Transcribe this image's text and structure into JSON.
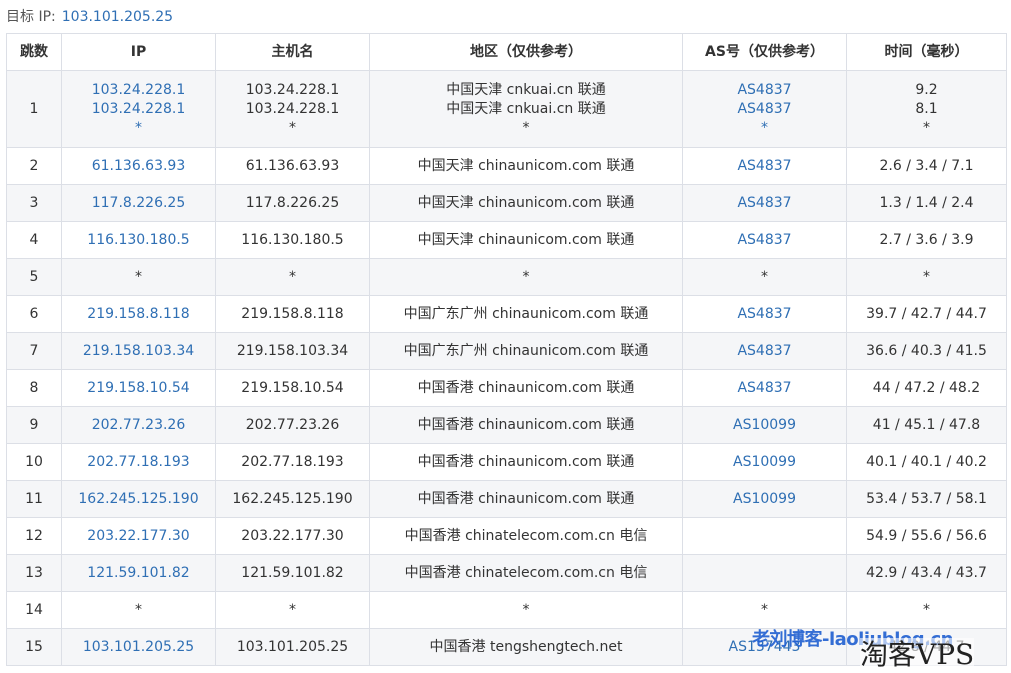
{
  "target": {
    "label": "目标 IP:",
    "ip": "103.101.205.25"
  },
  "headers": {
    "hop": "跳数",
    "ip": "IP",
    "host": "主机名",
    "region": "地区（仅供参考）",
    "as": "AS号（仅供参考）",
    "time": "时间（毫秒）"
  },
  "rows": [
    {
      "hop": "1",
      "ips": [
        "103.24.228.1",
        "103.24.228.1",
        "*"
      ],
      "hosts": [
        "103.24.228.1",
        "103.24.228.1",
        "*"
      ],
      "regions": [
        "中国天津 cnkuai.cn 联通",
        "中国天津 cnkuai.cn 联通",
        "*"
      ],
      "as": [
        "AS4837",
        "AS4837",
        "*"
      ],
      "times": [
        "9.2",
        "8.1",
        "*"
      ]
    },
    {
      "hop": "2",
      "ip": "61.136.63.93",
      "host": "61.136.63.93",
      "region": "中国天津 chinaunicom.com 联通",
      "as": "AS4837",
      "time": "2.6 / 3.4 / 7.1"
    },
    {
      "hop": "3",
      "ip": "117.8.226.25",
      "host": "117.8.226.25",
      "region": "中国天津 chinaunicom.com 联通",
      "as": "AS4837",
      "time": "1.3 / 1.4 / 2.4"
    },
    {
      "hop": "4",
      "ip": "116.130.180.5",
      "host": "116.130.180.5",
      "region": "中国天津 chinaunicom.com 联通",
      "as": "AS4837",
      "time": "2.7 / 3.6 / 3.9"
    },
    {
      "hop": "5",
      "ip": "*",
      "host": "*",
      "region": "*",
      "as": "*",
      "time": "*"
    },
    {
      "hop": "6",
      "ip": "219.158.8.118",
      "host": "219.158.8.118",
      "region": "中国广东广州 chinaunicom.com 联通",
      "as": "AS4837",
      "time": "39.7 / 42.7 / 44.7"
    },
    {
      "hop": "7",
      "ip": "219.158.103.34",
      "host": "219.158.103.34",
      "region": "中国广东广州 chinaunicom.com 联通",
      "as": "AS4837",
      "time": "36.6 / 40.3 / 41.5"
    },
    {
      "hop": "8",
      "ip": "219.158.10.54",
      "host": "219.158.10.54",
      "region": "中国香港 chinaunicom.com 联通",
      "as": "AS4837",
      "time": "44 / 47.2 / 48.2"
    },
    {
      "hop": "9",
      "ip": "202.77.23.26",
      "host": "202.77.23.26",
      "region": "中国香港 chinaunicom.com 联通",
      "as": "AS10099",
      "time": "41 / 45.1 / 47.8"
    },
    {
      "hop": "10",
      "ip": "202.77.18.193",
      "host": "202.77.18.193",
      "region": "中国香港 chinaunicom.com 联通",
      "as": "AS10099",
      "time": "40.1 / 40.1 / 40.2"
    },
    {
      "hop": "11",
      "ip": "162.245.125.190",
      "host": "162.245.125.190",
      "region": "中国香港 chinaunicom.com 联通",
      "as": "AS10099",
      "time": "53.4 / 53.7 / 58.1"
    },
    {
      "hop": "12",
      "ip": "203.22.177.30",
      "host": "203.22.177.30",
      "region": "中国香港 chinatelecom.com.cn 电信",
      "as": "",
      "time": "54.9 / 55.6 / 56.6"
    },
    {
      "hop": "13",
      "ip": "121.59.101.82",
      "host": "121.59.101.82",
      "region": "中国香港 chinatelecom.com.cn 电信",
      "as": "",
      "time": "42.9 / 43.4 / 43.7"
    },
    {
      "hop": "14",
      "ip": "*",
      "host": "*",
      "region": "*",
      "as": "*",
      "time": "*"
    },
    {
      "hop": "15",
      "ip": "103.101.205.25",
      "host": "103.101.205.25",
      "region": "中国香港 tengshengtech.net",
      "as": "AS137443",
      "time": "42.8 / 44.7"
    }
  ],
  "watermarks": {
    "blog": "老刘博客-laoliublog.cn",
    "vps": "淘客VPS"
  }
}
